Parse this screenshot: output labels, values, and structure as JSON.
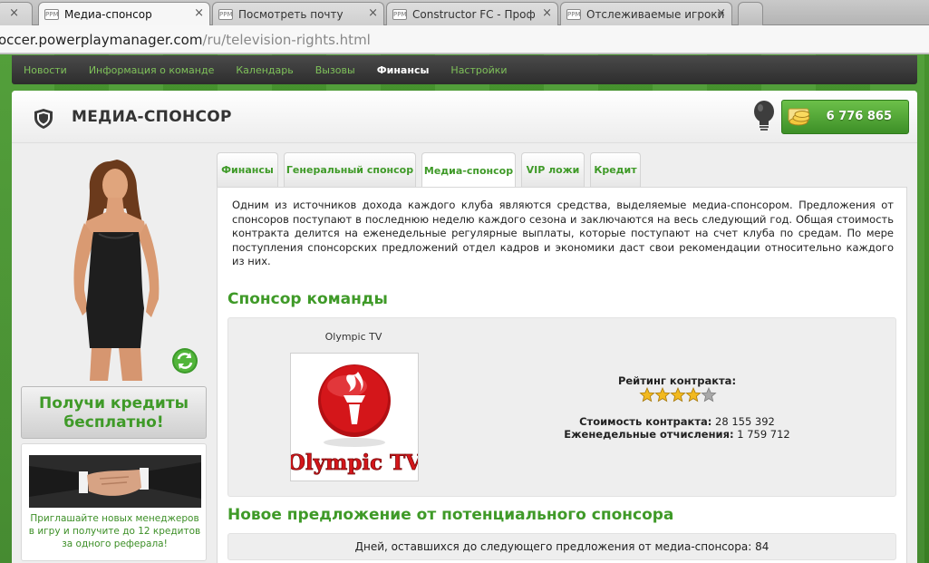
{
  "browser": {
    "tabs": [
      {
        "title": "Медиа-спонсор",
        "active": true
      },
      {
        "title": "Посмотреть почту",
        "active": false
      },
      {
        "title": "Constructor FC - Профиль",
        "active": false
      },
      {
        "title": "Отслеживаемые игроки",
        "active": false
      }
    ],
    "url_host": "occer.powerplaymanager.com",
    "url_path": "/ru/television-rights.html"
  },
  "nav": {
    "items": [
      {
        "label": "Новости",
        "active": false
      },
      {
        "label": "Информация о команде",
        "active": false
      },
      {
        "label": "Календарь",
        "active": false
      },
      {
        "label": "Вызовы",
        "active": false
      },
      {
        "label": "Финансы",
        "active": true
      },
      {
        "label": "Настройки",
        "active": false
      }
    ]
  },
  "header": {
    "title": "МЕДИА-СПОНСОР",
    "credits": "6 776 865"
  },
  "sidebar": {
    "promo_line1": "Получи кредиты",
    "promo_line2": "бесплатно!",
    "referral_text": "Приглашайте новых менеджеров в игру и получите до 12 кредитов за одного реферала!"
  },
  "tabs": [
    {
      "label": "Финансы",
      "active": false
    },
    {
      "label": "Генеральный спонсор",
      "active": false
    },
    {
      "label": "Медиа-спонсор",
      "active": true
    },
    {
      "label": "VIP ложи",
      "active": false
    },
    {
      "label": "Кредит",
      "active": false
    }
  ],
  "content": {
    "intro": "Одним из источников дохода каждого клуба являются средства, выделяемые медиа-спонсором. Предложения от спонсоров поступают в последнюю неделю каждого сезона и заключаются на весь следующий год. Общая стоимость контракта делится на еженедельные регулярные выплаты, которые поступают на счет клуба по средам. По мере поступления спонсорских предложений отдел кадров и экономики даст свои рекомендации относительно каждого из них.",
    "sponsor_section_title": "Спонсор команды",
    "sponsor": {
      "name": "Olympic TV",
      "logo_text": "Olympic TV",
      "rating_label": "Рейтинг контракта:",
      "rating": 4,
      "rating_max": 5,
      "contract_value_label": "Стоимость контракта:",
      "contract_value": "28 155 392",
      "weekly_label": "Еженедельные отчисления:",
      "weekly_value": "1 759 712"
    },
    "offer_section_title": "Новое предложение от потенциального спонсора",
    "days_label": "Дней, оставшихся до следующего предложения от медиа-спонсора:",
    "days_value": "84"
  },
  "colors": {
    "brand_green": "#3f9a28",
    "nav_dark": "#2d2d2d",
    "star_gold": "#f2b91f",
    "star_grey": "#a8a8a8",
    "logo_red": "#d4161a"
  }
}
